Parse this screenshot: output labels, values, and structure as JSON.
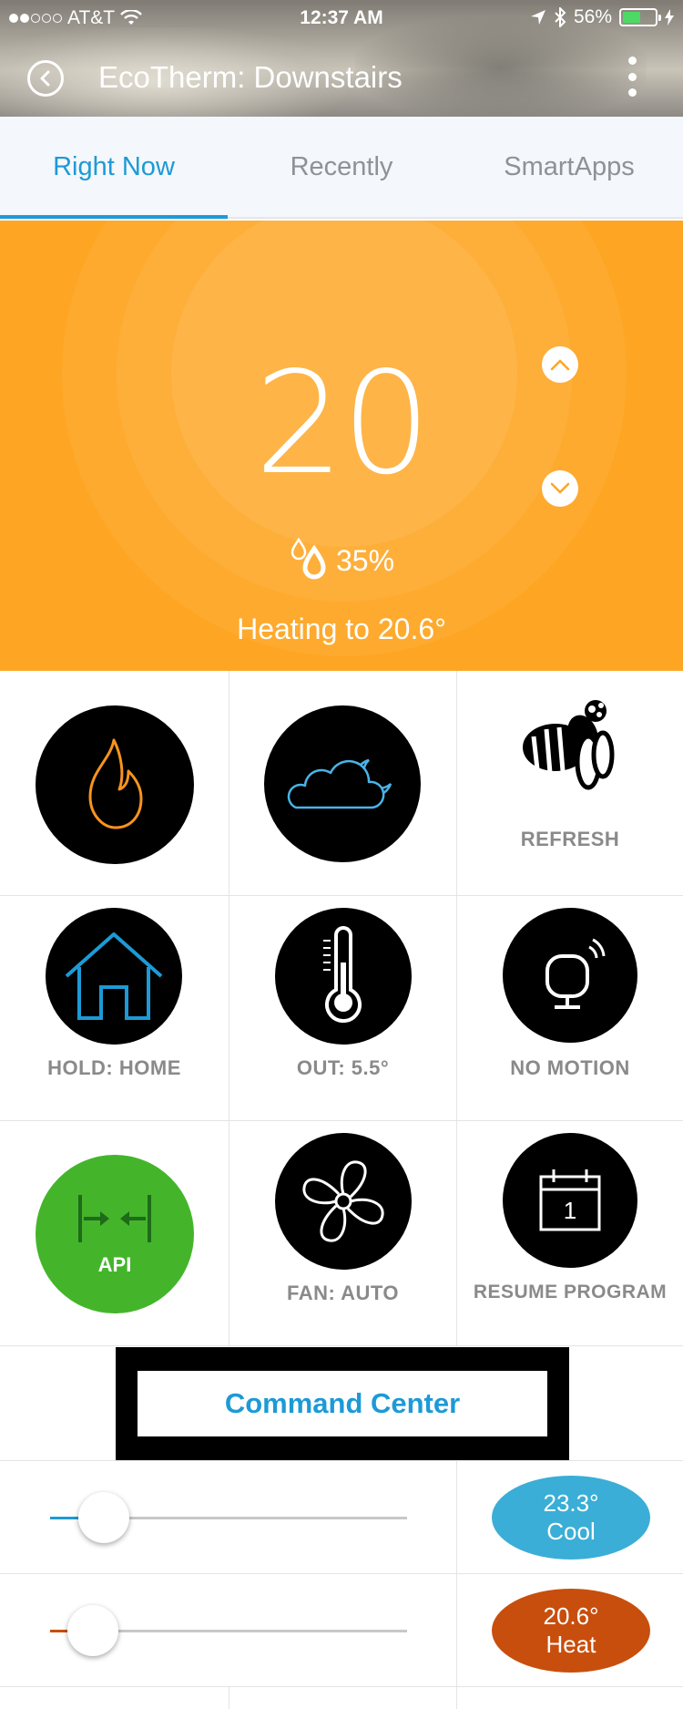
{
  "status_bar": {
    "carrier": "AT&T",
    "time": "12:37 AM",
    "battery_percent": "56%",
    "battery_level": 0.56,
    "signal_dots": [
      true,
      true,
      false,
      false,
      false
    ]
  },
  "nav": {
    "title": "EcoTherm: Downstairs",
    "back_icon": "back-chevron-icon",
    "more_icon": "more-vertical-icon"
  },
  "tabs": [
    {
      "label": "Right Now",
      "active": true
    },
    {
      "label": "Recently",
      "active": false
    },
    {
      "label": "SmartApps",
      "active": false
    }
  ],
  "thermostat": {
    "setpoint": "20",
    "humidity": "35%",
    "status": "Heating to 20.6°",
    "background_color": "#fea623"
  },
  "tiles": [
    [
      {
        "icon": "flame-icon",
        "label": ""
      },
      {
        "icon": "cloud-moon-icon",
        "label": ""
      },
      {
        "icon": "bee-icon",
        "label": "REFRESH"
      }
    ],
    [
      {
        "icon": "house-icon",
        "label": "HOLD: HOME"
      },
      {
        "icon": "thermometer-icon",
        "label": "OUT: 5.5°"
      },
      {
        "icon": "motion-sensor-icon",
        "label": "NO MOTION"
      }
    ],
    [
      {
        "icon": "api-arrows-icon",
        "label": "API",
        "color": "#44b52b"
      },
      {
        "icon": "fan-icon",
        "label": "FAN: AUTO"
      },
      {
        "icon": "calendar-icon",
        "label": "RESUME PROGRAM",
        "calendar_day": "1"
      }
    ]
  ],
  "command_center": {
    "label": "Command Center"
  },
  "cool": {
    "value": "23.3°",
    "mode": "Cool",
    "slider_level": 0.15,
    "color": "#3aaed6",
    "track_color": "#1d9ad6"
  },
  "heat": {
    "value": "20.6°",
    "mode": "Heat",
    "slider_level": 0.12,
    "color": "#c84e0d",
    "track_color": "#c84e0d"
  }
}
